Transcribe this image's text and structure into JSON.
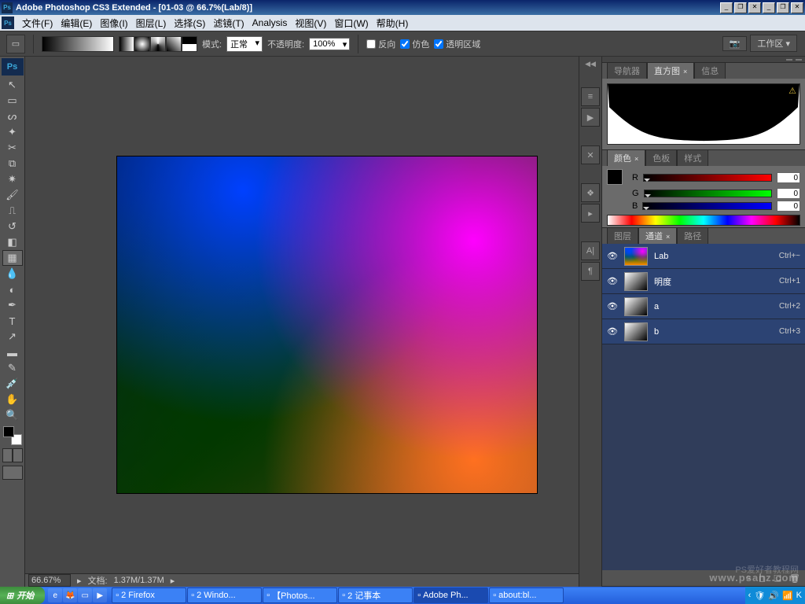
{
  "titlebar": {
    "title": "Adobe Photoshop CS3 Extended - [01-03 @ 66.7%(Lab/8)]"
  },
  "menu": {
    "file": "文件(F)",
    "edit": "编辑(E)",
    "image": "图像(I)",
    "layer": "图层(L)",
    "select": "选择(S)",
    "filter": "滤镜(T)",
    "analysis": "Analysis",
    "view": "视图(V)",
    "window": "窗口(W)",
    "help": "帮助(H)"
  },
  "options": {
    "mode_label": "模式:",
    "mode_value": "正常",
    "opacity_label": "不透明度:",
    "opacity_value": "100%",
    "reverse": "反向",
    "dither": "仿色",
    "transparency": "透明区域",
    "workspace": "工作区"
  },
  "status": {
    "zoom": "66.67%",
    "doc_label": "文档:",
    "doc_value": "1.37M/1.37M"
  },
  "panels": {
    "nav": {
      "tab_nav": "导航器",
      "tab_hist": "直方图",
      "tab_info": "信息"
    },
    "color": {
      "tab_color": "颜色",
      "tab_swatch": "色板",
      "tab_style": "样式",
      "r_label": "R",
      "g_label": "G",
      "b_label": "B",
      "r_val": "0",
      "g_val": "0",
      "b_val": "0"
    },
    "layers": {
      "tab_layer": "图层",
      "tab_channel": "通道",
      "tab_path": "路径",
      "channels": [
        {
          "name": "Lab",
          "shortcut": "Ctrl+~",
          "thumb": "lab"
        },
        {
          "name": "明度",
          "shortcut": "Ctrl+1",
          "thumb": "gray"
        },
        {
          "name": "a",
          "shortcut": "Ctrl+2",
          "thumb": "gray"
        },
        {
          "name": "b",
          "shortcut": "Ctrl+3",
          "thumb": "gray"
        }
      ]
    }
  },
  "taskbar": {
    "start": "开始",
    "tasks": [
      {
        "label": "2 Firefox"
      },
      {
        "label": "2 Windo..."
      },
      {
        "label": "【Photos..."
      },
      {
        "label": "2 记事本"
      },
      {
        "label": "Adobe Ph..."
      },
      {
        "label": "about:bl..."
      }
    ]
  },
  "watermark": {
    "line1": "PS爱好者教程网",
    "line2": "www.psahz.com"
  }
}
